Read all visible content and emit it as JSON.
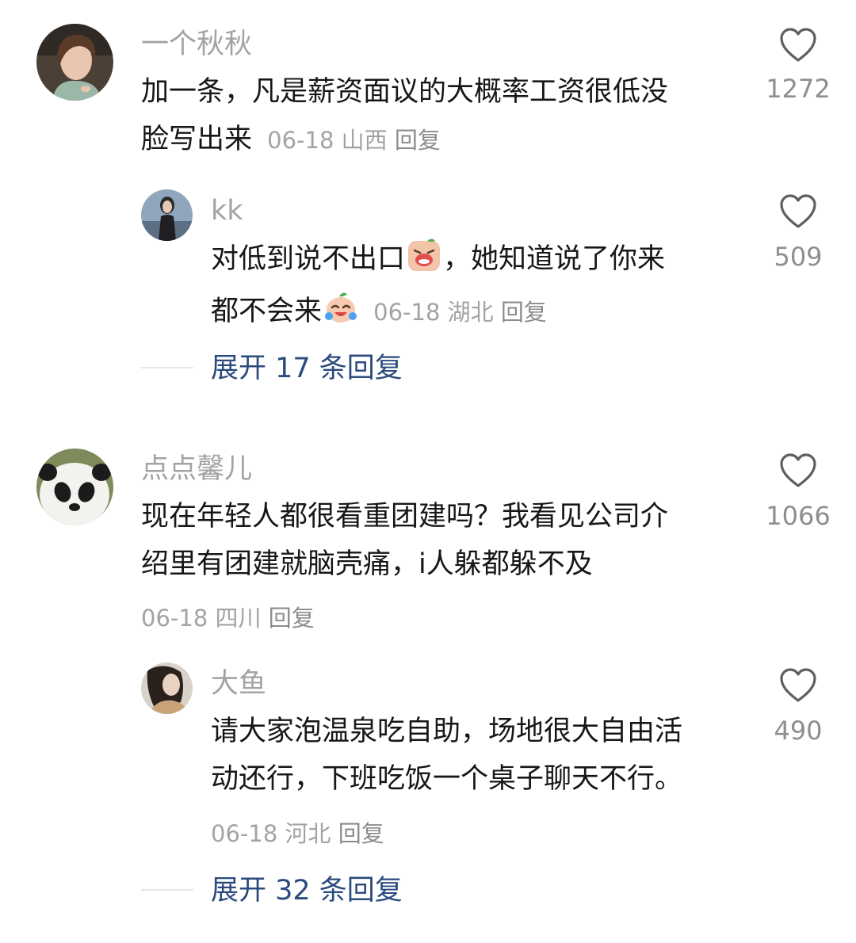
{
  "comments": [
    {
      "username": "一个秋秋",
      "text_line1": "加一条，凡是薪资面议的大概率工资很低没",
      "text_line2": "脸写出来",
      "date": "06-18",
      "location": "山西",
      "reply_label": "回复",
      "likes": "1272",
      "avatar_icon": "woman-portrait-avatar"
    },
    {
      "username": "kk",
      "text_line1_a": "对低到说不出口",
      "text_line1_b": "，她知道说了你来",
      "text_line2": "都不会来",
      "emoji1": "crying-face-emoji",
      "emoji2": "laughing-tears-emoji",
      "date": "06-18",
      "location": "湖北",
      "reply_label": "回复",
      "likes": "509",
      "avatar_icon": "girl-portrait-avatar"
    },
    {
      "username": "点点馨儿",
      "text_line1": "现在年轻人都很看重团建吗？我看见公司介",
      "text_line2": "绍里有团建就脑壳痛，i人躲都躲不及",
      "date": "06-18",
      "location": "四川",
      "reply_label": "回复",
      "likes": "1066",
      "avatar_icon": "panda-avatar"
    },
    {
      "username": "大鱼",
      "text_line1": "请大家泡温泉吃自助，场地很大自由活",
      "text_line2": "动还行，下班吃饭一个桌子聊天不行。",
      "date": "06-18",
      "location": "河北",
      "reply_label": "回复",
      "likes": "490",
      "avatar_icon": "woman-side-portrait-avatar"
    }
  ],
  "expand_replies": [
    {
      "label": "展开 17 条回复"
    },
    {
      "label": "展开 32 条回复"
    }
  ],
  "colors": {
    "username": "#a3a3a3",
    "text": "#171717",
    "meta": "#a3a3a3",
    "expand_link": "#2b4a7e",
    "like_icon": "#5f5f5f"
  }
}
